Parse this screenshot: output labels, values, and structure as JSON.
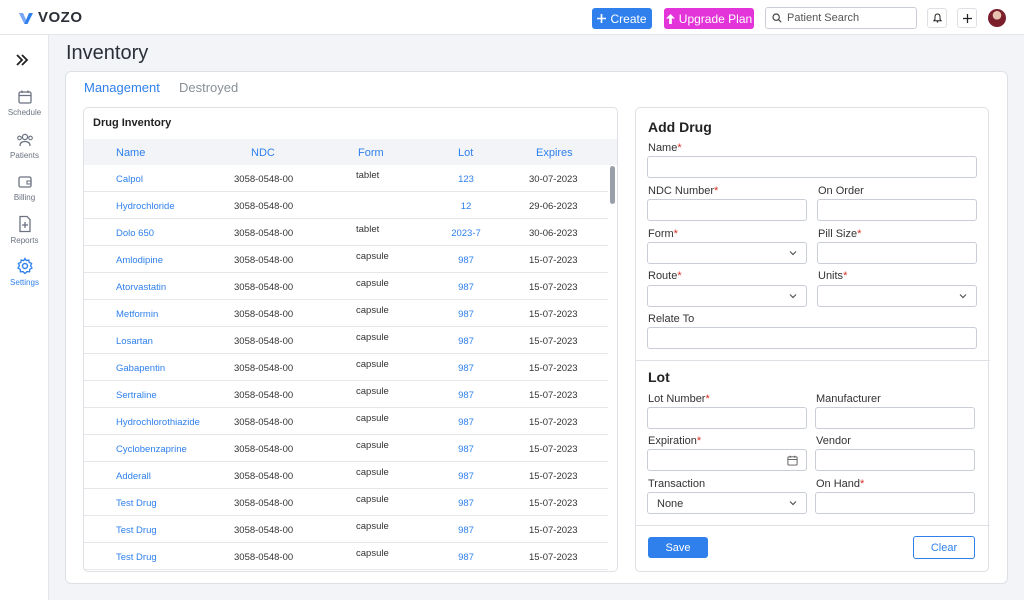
{
  "brand": {
    "name": "VOZO",
    "color": "#2f80ed"
  },
  "topbar": {
    "create_label": "Create",
    "upgrade_label": "Upgrade Plan",
    "search_placeholder": "Patient Search"
  },
  "sidebar": {
    "items": [
      {
        "label": "Schedule",
        "icon": "calendar-icon"
      },
      {
        "label": "Patients",
        "icon": "users-icon"
      },
      {
        "label": "Billing",
        "icon": "wallet-icon"
      },
      {
        "label": "Reports",
        "icon": "report-icon"
      },
      {
        "label": "Settings",
        "icon": "gear-icon",
        "active": true
      }
    ]
  },
  "page": {
    "title": "Inventory",
    "tabs": [
      {
        "label": "Management",
        "active": true
      },
      {
        "label": "Destroyed"
      }
    ]
  },
  "inventory": {
    "title": "Drug Inventory",
    "columns": [
      "Name",
      "NDC",
      "Form",
      "Lot",
      "Expires"
    ],
    "rows": [
      {
        "name": "Calpol",
        "ndc": "3058-0548-00",
        "form": "tablet",
        "lot": "123",
        "expires": "30-07-2023"
      },
      {
        "name": "Hydrochloride",
        "ndc": "3058-0548-00",
        "form": "",
        "lot": "12",
        "expires": "29-06-2023"
      },
      {
        "name": "Dolo 650",
        "ndc": "3058-0548-00",
        "form": "tablet",
        "lot": "2023-7",
        "expires": "30-06-2023"
      },
      {
        "name": "Amlodipine",
        "ndc": "3058-0548-00",
        "form": "capsule",
        "lot": "987",
        "expires": "15-07-2023"
      },
      {
        "name": "Atorvastatin",
        "ndc": "3058-0548-00",
        "form": "capsule",
        "lot": "987",
        "expires": "15-07-2023"
      },
      {
        "name": "Metformin",
        "ndc": "3058-0548-00",
        "form": "capsule",
        "lot": "987",
        "expires": "15-07-2023"
      },
      {
        "name": "Losartan",
        "ndc": "3058-0548-00",
        "form": "capsule",
        "lot": "987",
        "expires": "15-07-2023"
      },
      {
        "name": "Gabapentin",
        "ndc": "3058-0548-00",
        "form": "capsule",
        "lot": "987",
        "expires": "15-07-2023"
      },
      {
        "name": "Sertraline",
        "ndc": "3058-0548-00",
        "form": "capsule",
        "lot": "987",
        "expires": "15-07-2023"
      },
      {
        "name": "Hydrochlorothiazide",
        "ndc": "3058-0548-00",
        "form": "capsule",
        "lot": "987",
        "expires": "15-07-2023"
      },
      {
        "name": "Cyclobenzaprine",
        "ndc": "3058-0548-00",
        "form": "capsule",
        "lot": "987",
        "expires": "15-07-2023"
      },
      {
        "name": "Adderall",
        "ndc": "3058-0548-00",
        "form": "capsule",
        "lot": "987",
        "expires": "15-07-2023"
      },
      {
        "name": "Test Drug",
        "ndc": "3058-0548-00",
        "form": "capsule",
        "lot": "987",
        "expires": "15-07-2023"
      },
      {
        "name": "Test Drug",
        "ndc": "3058-0548-00",
        "form": "capsule",
        "lot": "987",
        "expires": "15-07-2023"
      },
      {
        "name": "Test Drug",
        "ndc": "3058-0548-00",
        "form": "capsule",
        "lot": "987",
        "expires": "15-07-2023"
      }
    ]
  },
  "add_drug": {
    "title": "Add Drug",
    "name_label": "Name",
    "ndc_label": "NDC Number",
    "on_order_label": "On Order",
    "form_label": "Form",
    "pill_size_label": "Pill Size",
    "route_label": "Route",
    "units_label": "Units",
    "relate_to_label": "Relate To"
  },
  "lot": {
    "title": "Lot",
    "lot_number_label": "Lot Number",
    "manufacturer_label": "Manufacturer",
    "expiration_label": "Expiration",
    "vendor_label": "Vendor",
    "transaction_label": "Transaction",
    "transaction_value": "None",
    "on_hand_label": "On Hand"
  },
  "actions": {
    "save_label": "Save",
    "clear_label": "Clear"
  },
  "required_mark": "*"
}
